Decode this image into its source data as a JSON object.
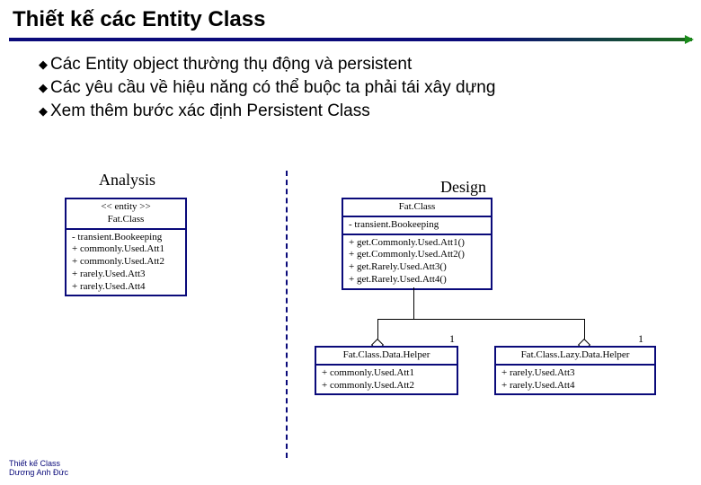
{
  "title": "Thiết kế các Entity Class",
  "bullets": [
    "Các Entity object thường thụ động và persistent",
    "Các yêu cầu về hiệu năng có thể buộc ta phải tái xây dựng",
    "Xem thêm bước xác định Persistent Class"
  ],
  "analysis_label": "Analysis",
  "design_label": "Design",
  "mult1": "1",
  "mult2": "1",
  "left_fat": {
    "head": "<< entity >>\nFat.Class",
    "attrs": "- transient.Bookeeping\n+ commonly.Used.Att1\n+ commonly.Used.Att2\n+ rarely.Used.Att3\n+ rarely.Used.Att4"
  },
  "right_fat": {
    "head": "Fat.Class",
    "attrs": "- transient.Bookeeping",
    "ops": "+ get.Commonly.Used.Att1()\n+ get.Commonly.Used.Att2()\n+ get.Rarely.Used.Att3()\n+ get.Rarely.Used.Att4()"
  },
  "helper1": {
    "head": "Fat.Class.Data.Helper",
    "attrs": "+ commonly.Used.Att1\n+ commonly.Used.Att2"
  },
  "helper2": {
    "head": "Fat.Class.Lazy.Data.Helper",
    "attrs": "+ rarely.Used.Att3\n+ rarely.Used.Att4"
  },
  "footer": {
    "line1": "Thiết kế Class",
    "line2": "Dương Anh Đức"
  }
}
